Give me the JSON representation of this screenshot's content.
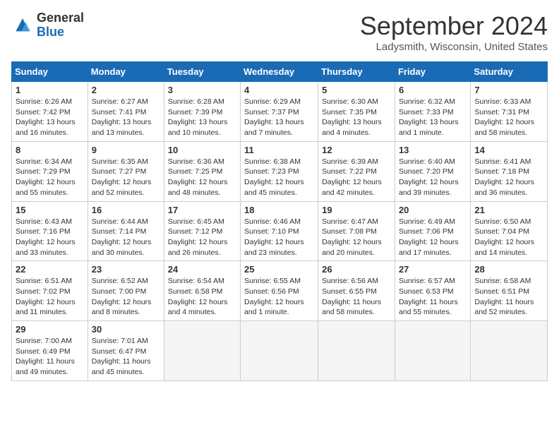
{
  "logo": {
    "general": "General",
    "blue": "Blue"
  },
  "title": "September 2024",
  "location": "Ladysmith, Wisconsin, United States",
  "days_of_week": [
    "Sunday",
    "Monday",
    "Tuesday",
    "Wednesday",
    "Thursday",
    "Friday",
    "Saturday"
  ],
  "weeks": [
    [
      {
        "day": "1",
        "info": "Sunrise: 6:26 AM\nSunset: 7:42 PM\nDaylight: 13 hours\nand 16 minutes."
      },
      {
        "day": "2",
        "info": "Sunrise: 6:27 AM\nSunset: 7:41 PM\nDaylight: 13 hours\nand 13 minutes."
      },
      {
        "day": "3",
        "info": "Sunrise: 6:28 AM\nSunset: 7:39 PM\nDaylight: 13 hours\nand 10 minutes."
      },
      {
        "day": "4",
        "info": "Sunrise: 6:29 AM\nSunset: 7:37 PM\nDaylight: 13 hours\nand 7 minutes."
      },
      {
        "day": "5",
        "info": "Sunrise: 6:30 AM\nSunset: 7:35 PM\nDaylight: 13 hours\nand 4 minutes."
      },
      {
        "day": "6",
        "info": "Sunrise: 6:32 AM\nSunset: 7:33 PM\nDaylight: 13 hours\nand 1 minute."
      },
      {
        "day": "7",
        "info": "Sunrise: 6:33 AM\nSunset: 7:31 PM\nDaylight: 12 hours\nand 58 minutes."
      }
    ],
    [
      {
        "day": "8",
        "info": "Sunrise: 6:34 AM\nSunset: 7:29 PM\nDaylight: 12 hours\nand 55 minutes."
      },
      {
        "day": "9",
        "info": "Sunrise: 6:35 AM\nSunset: 7:27 PM\nDaylight: 12 hours\nand 52 minutes."
      },
      {
        "day": "10",
        "info": "Sunrise: 6:36 AM\nSunset: 7:25 PM\nDaylight: 12 hours\nand 48 minutes."
      },
      {
        "day": "11",
        "info": "Sunrise: 6:38 AM\nSunset: 7:23 PM\nDaylight: 12 hours\nand 45 minutes."
      },
      {
        "day": "12",
        "info": "Sunrise: 6:39 AM\nSunset: 7:22 PM\nDaylight: 12 hours\nand 42 minutes."
      },
      {
        "day": "13",
        "info": "Sunrise: 6:40 AM\nSunset: 7:20 PM\nDaylight: 12 hours\nand 39 minutes."
      },
      {
        "day": "14",
        "info": "Sunrise: 6:41 AM\nSunset: 7:18 PM\nDaylight: 12 hours\nand 36 minutes."
      }
    ],
    [
      {
        "day": "15",
        "info": "Sunrise: 6:43 AM\nSunset: 7:16 PM\nDaylight: 12 hours\nand 33 minutes."
      },
      {
        "day": "16",
        "info": "Sunrise: 6:44 AM\nSunset: 7:14 PM\nDaylight: 12 hours\nand 30 minutes."
      },
      {
        "day": "17",
        "info": "Sunrise: 6:45 AM\nSunset: 7:12 PM\nDaylight: 12 hours\nand 26 minutes."
      },
      {
        "day": "18",
        "info": "Sunrise: 6:46 AM\nSunset: 7:10 PM\nDaylight: 12 hours\nand 23 minutes."
      },
      {
        "day": "19",
        "info": "Sunrise: 6:47 AM\nSunset: 7:08 PM\nDaylight: 12 hours\nand 20 minutes."
      },
      {
        "day": "20",
        "info": "Sunrise: 6:49 AM\nSunset: 7:06 PM\nDaylight: 12 hours\nand 17 minutes."
      },
      {
        "day": "21",
        "info": "Sunrise: 6:50 AM\nSunset: 7:04 PM\nDaylight: 12 hours\nand 14 minutes."
      }
    ],
    [
      {
        "day": "22",
        "info": "Sunrise: 6:51 AM\nSunset: 7:02 PM\nDaylight: 12 hours\nand 11 minutes."
      },
      {
        "day": "23",
        "info": "Sunrise: 6:52 AM\nSunset: 7:00 PM\nDaylight: 12 hours\nand 8 minutes."
      },
      {
        "day": "24",
        "info": "Sunrise: 6:54 AM\nSunset: 6:58 PM\nDaylight: 12 hours\nand 4 minutes."
      },
      {
        "day": "25",
        "info": "Sunrise: 6:55 AM\nSunset: 6:56 PM\nDaylight: 12 hours\nand 1 minute."
      },
      {
        "day": "26",
        "info": "Sunrise: 6:56 AM\nSunset: 6:55 PM\nDaylight: 11 hours\nand 58 minutes."
      },
      {
        "day": "27",
        "info": "Sunrise: 6:57 AM\nSunset: 6:53 PM\nDaylight: 11 hours\nand 55 minutes."
      },
      {
        "day": "28",
        "info": "Sunrise: 6:58 AM\nSunset: 6:51 PM\nDaylight: 11 hours\nand 52 minutes."
      }
    ],
    [
      {
        "day": "29",
        "info": "Sunrise: 7:00 AM\nSunset: 6:49 PM\nDaylight: 11 hours\nand 49 minutes."
      },
      {
        "day": "30",
        "info": "Sunrise: 7:01 AM\nSunset: 6:47 PM\nDaylight: 11 hours\nand 45 minutes."
      },
      {
        "day": "",
        "info": ""
      },
      {
        "day": "",
        "info": ""
      },
      {
        "day": "",
        "info": ""
      },
      {
        "day": "",
        "info": ""
      },
      {
        "day": "",
        "info": ""
      }
    ]
  ]
}
